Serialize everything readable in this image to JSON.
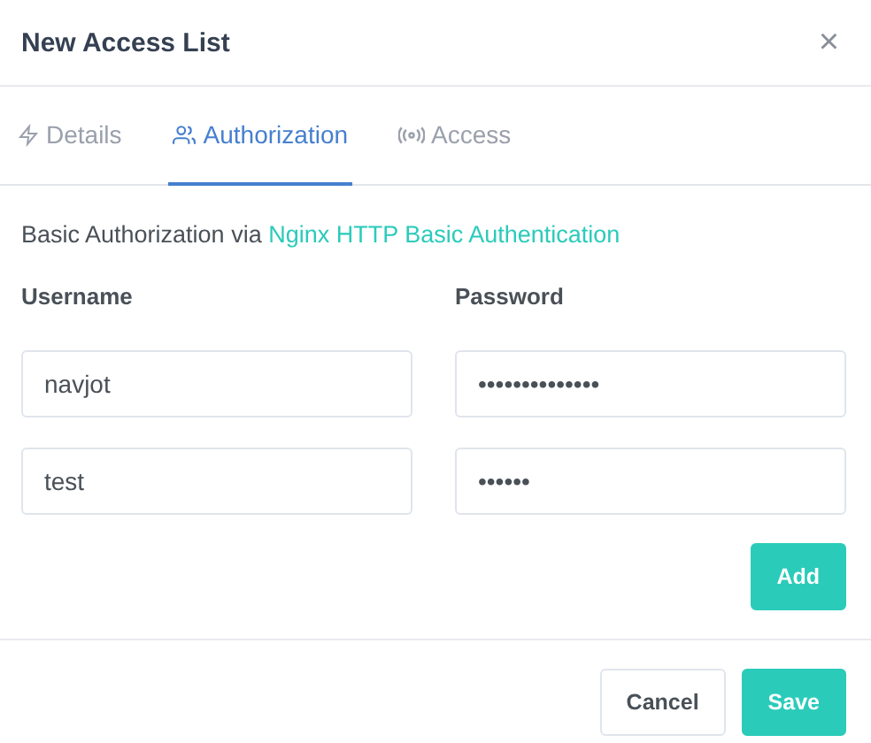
{
  "dialog": {
    "title": "New Access List",
    "close": "×"
  },
  "tabs": [
    {
      "label": "Details",
      "kind": "bolt",
      "selected": false
    },
    {
      "label": "Authorization",
      "kind": "users",
      "selected": true
    },
    {
      "label": "Access",
      "kind": "signal",
      "selected": false
    }
  ],
  "intro": {
    "text": "Basic Authorization via",
    "link": "Nginx HTTP Basic Authentication"
  },
  "columns": [
    "Username",
    "Password"
  ],
  "rows": [
    {
      "username": "navjot",
      "password": "••••••••••••••"
    },
    {
      "username": "test",
      "password": "••••••"
    }
  ],
  "add_button": "Add",
  "footer": {
    "cancel": "Cancel",
    "save": "Save"
  }
}
